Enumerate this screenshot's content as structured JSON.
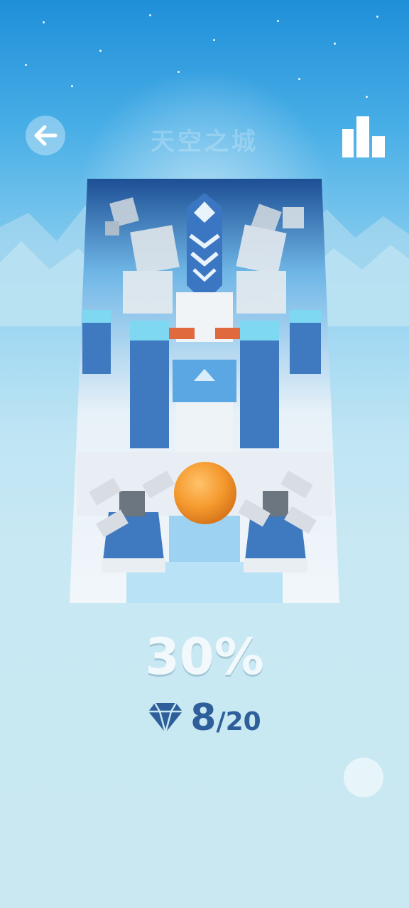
{
  "header": {
    "title": "天空之城",
    "back_icon": "arrow-left-icon",
    "leaderboard_icon": "bar-chart-icon"
  },
  "level": {
    "progress": "30%",
    "progress_fraction": 0.3,
    "gems_collected": "8",
    "gems_total": "/20",
    "gem_icon": "diamond-icon"
  },
  "footer": {
    "music_icon": "disc-icon"
  },
  "colors": {
    "sky_top": "#1f8fd9",
    "background": "#c8e8f3",
    "progress_text": "#f2f9fc",
    "gem_text": "#2f5f9a",
    "ball": "#f59a2e"
  }
}
